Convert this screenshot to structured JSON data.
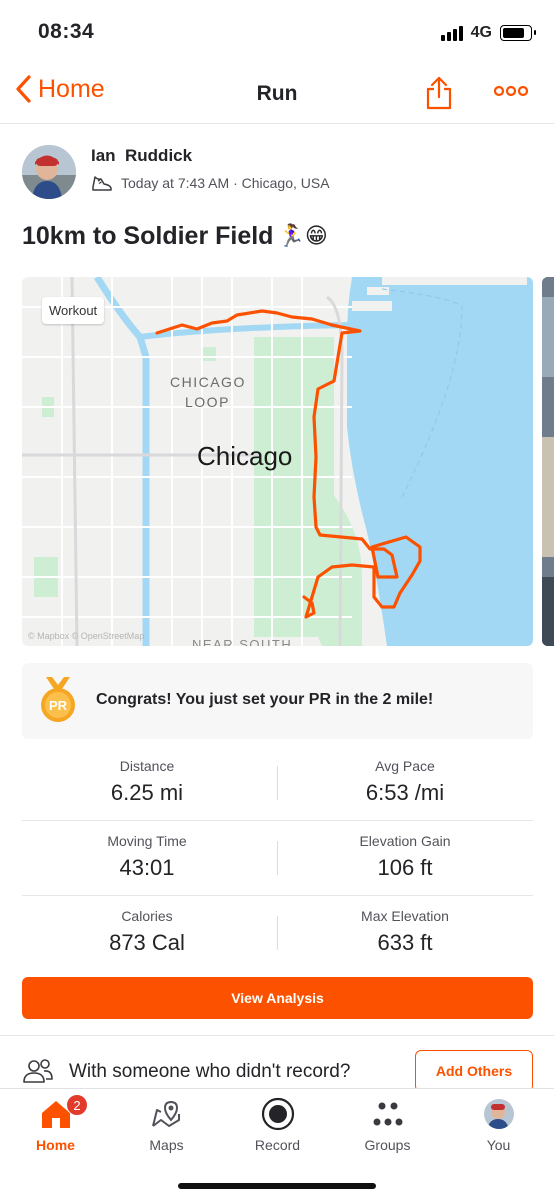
{
  "status_bar": {
    "time": "08:34",
    "network": "4G"
  },
  "nav": {
    "back_label": "Home",
    "title": "Run"
  },
  "activity": {
    "athlete_name": "Ian  Ruddick",
    "meta": "Today at 7:43 AM · Chicago, USA",
    "title": "10km to Soldier Field",
    "title_emoji": "🏃‍♀️😁"
  },
  "map": {
    "tag": "Workout",
    "city_label": "Chicago",
    "district_label_1": "CHICAGO",
    "district_label_2": "LOOP",
    "neighborhood_label": "NEAR SOUTH",
    "attribution": "© Mapbox © OpenStreetMap",
    "route_color": "#fc5200",
    "water_color": "#a3d8f5"
  },
  "achievement": {
    "label": "PR",
    "text": "Congrats! You just set your PR in the 2 mile!"
  },
  "stats": [
    {
      "left_label": "Distance",
      "left_value": "6.25 mi",
      "right_label": "Avg Pace",
      "right_value": "6:53 /mi"
    },
    {
      "left_label": "Moving Time",
      "left_value": "43:01",
      "right_label": "Elevation Gain",
      "right_value": "106 ft"
    },
    {
      "left_label": "Calories",
      "left_value": "873 Cal",
      "right_label": "Max Elevation",
      "right_value": "633 ft"
    }
  ],
  "actions": {
    "view_analysis": "View Analysis",
    "others_prompt": "With someone who didn't record?",
    "add_others": "Add Others"
  },
  "tab_bar": {
    "home": "Home",
    "home_badge": "2",
    "maps": "Maps",
    "record": "Record",
    "groups": "Groups",
    "you": "You"
  },
  "colors": {
    "accent": "#fc5200",
    "badge": "#e23b2b"
  }
}
